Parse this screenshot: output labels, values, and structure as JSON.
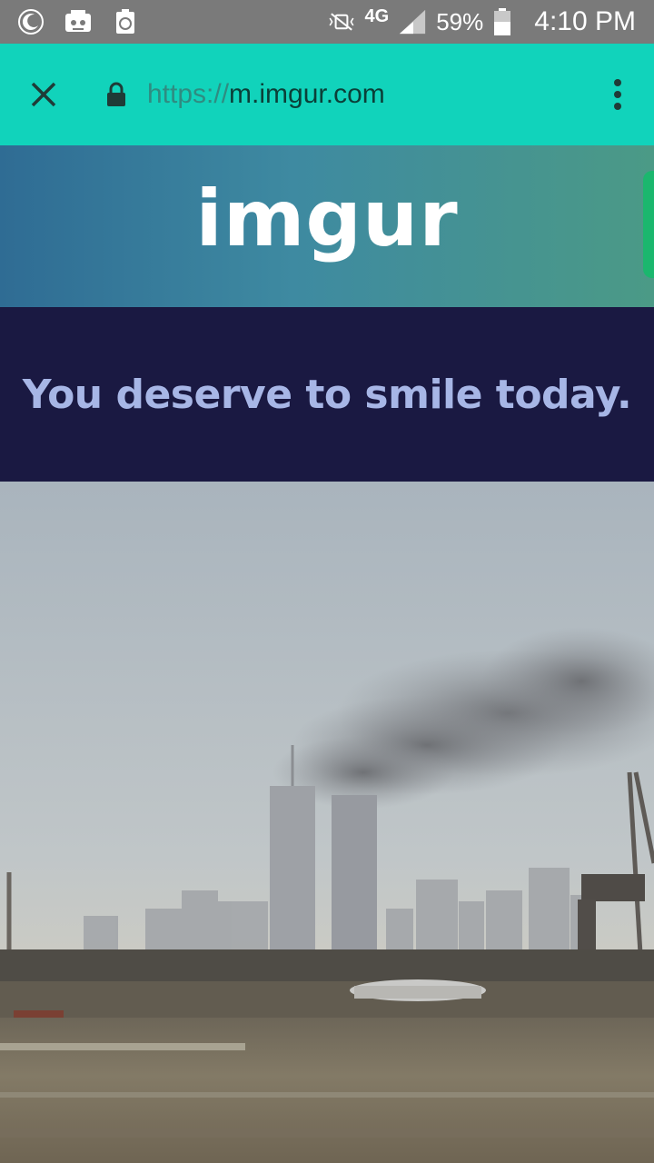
{
  "status_bar": {
    "network": "4G",
    "battery": "59%",
    "time": "4:10 PM",
    "icons": [
      "moon-icon",
      "game-controller-icon",
      "recycle-icon",
      "mute-vibrate-icon",
      "signal-icon",
      "battery-icon"
    ]
  },
  "browser": {
    "url_scheme": "https://",
    "url_host": "m.imgur.com",
    "toolbar_color": "#11d3bb"
  },
  "header": {
    "logo_text": "imgur"
  },
  "banner": {
    "text": "You deserve to smile today.",
    "bg_color": "#1a1942",
    "text_color": "#a7b6e6"
  }
}
